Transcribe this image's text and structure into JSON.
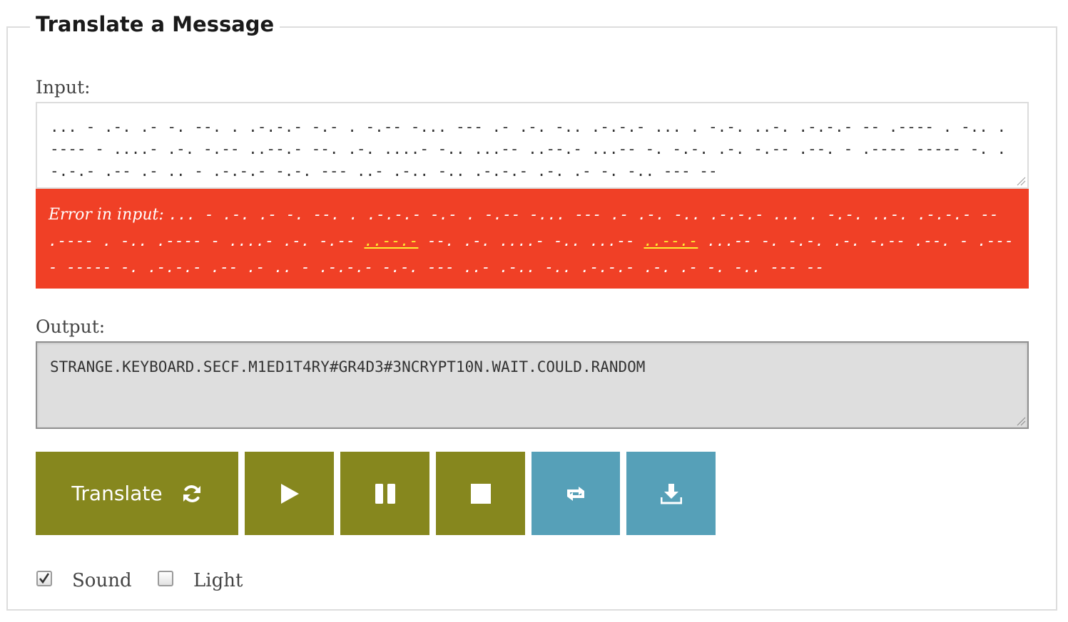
{
  "panel": {
    "title": "Translate a Message"
  },
  "input": {
    "label": "Input:",
    "value": "... - .-. .- -. --. . .-.-.- -.- . -.-- -... --- .- .-. -.. .-.-.- ... . -.-. ..-. .-.-.- -- .---- . -.. .---- - ....- .-. -.-- ..--.- --. .-. ....- -.. ...-- ..--.- ...-- -. -.-. .-. -.-- .--. - .---- ----- -. .-.-.- .-- .- .. - .-.-.- -.-. --- ..- .-.. -.. .-.-.- .-. .- -. -.. --- --"
  },
  "error": {
    "label": "Error in input:",
    "segment_1": "... - .-. .- -. --. . .-.-.- -.- . -.-- -... --- .- .-. -.. .-.-.- ... . -.-. ..-. .-.-.- -- .---- . -.. .---- - ....- .-. -.-- ",
    "highlight_1": "..--.-",
    "segment_2": " --. .-. ....- -.. ...-- ",
    "highlight_2": "..--.-",
    "segment_3": " ...-- -. -.-. .-. -.-- .--. - .---- ----- -. .-.-.- .-- .- .. - .-.-.- -.-. --- ..- .-.. -.. .-.-.- .-. .- -. -.. --- --"
  },
  "output": {
    "label": "Output:",
    "value": "STRANGE.KEYBOARD.SECF.M1ED1T4RY#GR4D3#3NCRYPT10N.WAIT.COULD.RANDOM"
  },
  "buttons": {
    "translate_label": "Translate",
    "translate_icon": "refresh-icon",
    "play_icon": "play-icon",
    "pause_icon": "pause-icon",
    "stop_icon": "stop-icon",
    "repeat_icon": "repeat-icon",
    "download_icon": "download-icon"
  },
  "options": {
    "sound_label": "Sound",
    "sound_checked": true,
    "light_label": "Light",
    "light_checked": false
  },
  "colors": {
    "olive_button": "#86871e",
    "blue_button": "#56a0b8",
    "error_background": "#f04026",
    "error_highlight": "#ffee33",
    "output_background": "#dedede"
  }
}
